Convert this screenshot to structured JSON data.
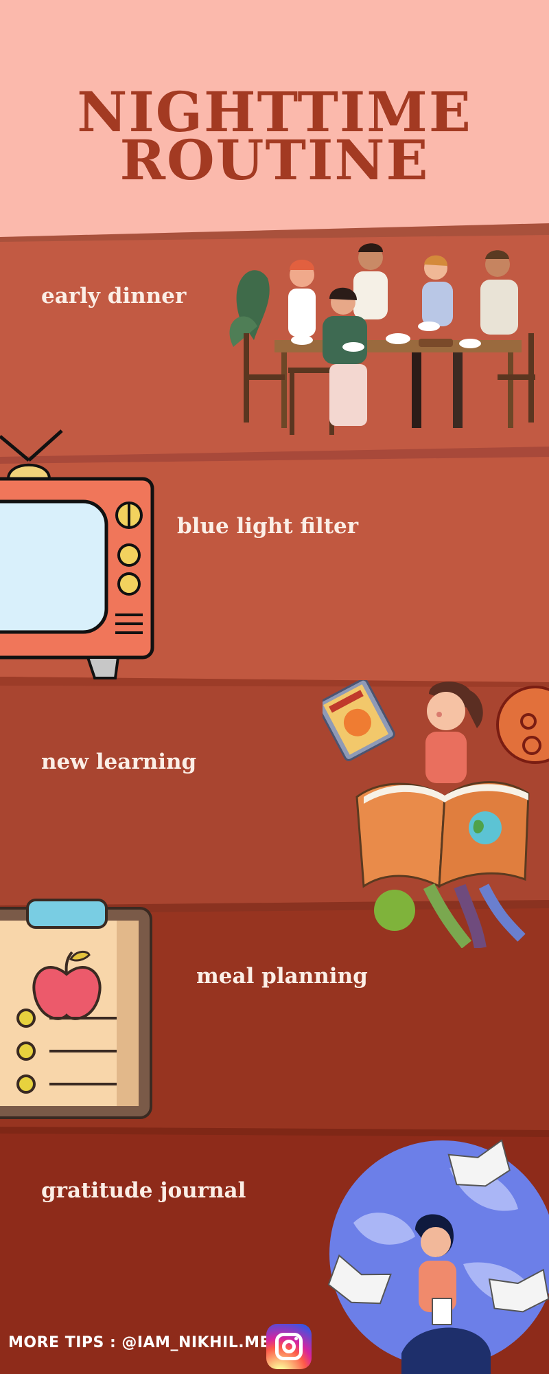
{
  "title": {
    "line1": "NIGHTTIME",
    "line2": "ROUTINE"
  },
  "sections": [
    {
      "label": "early dinner",
      "illustration": "friends-dining-illustration"
    },
    {
      "label": "blue light filter",
      "illustration": "retro-tv-icon"
    },
    {
      "label": "new learning",
      "illustration": "girl-reading-book-illustration"
    },
    {
      "label": "meal planning",
      "illustration": "clipboard-apple-checklist-icon"
    },
    {
      "label": "gratitude journal",
      "illustration": "woman-writing-globe-illustration"
    }
  ],
  "footer": {
    "prefix": "MORE TIPS :",
    "handle": "@IAM_NIKHIL.MEHRA",
    "icon": "instagram-icon"
  },
  "colors": {
    "header_bg": "#fbb9ac",
    "title": "#a33a22",
    "band1": "#c25a43",
    "band2": "#c15840",
    "band3": "#a94530",
    "band4": "#973420",
    "band5": "#8e2b1a",
    "label_text": "#fbeee6"
  }
}
